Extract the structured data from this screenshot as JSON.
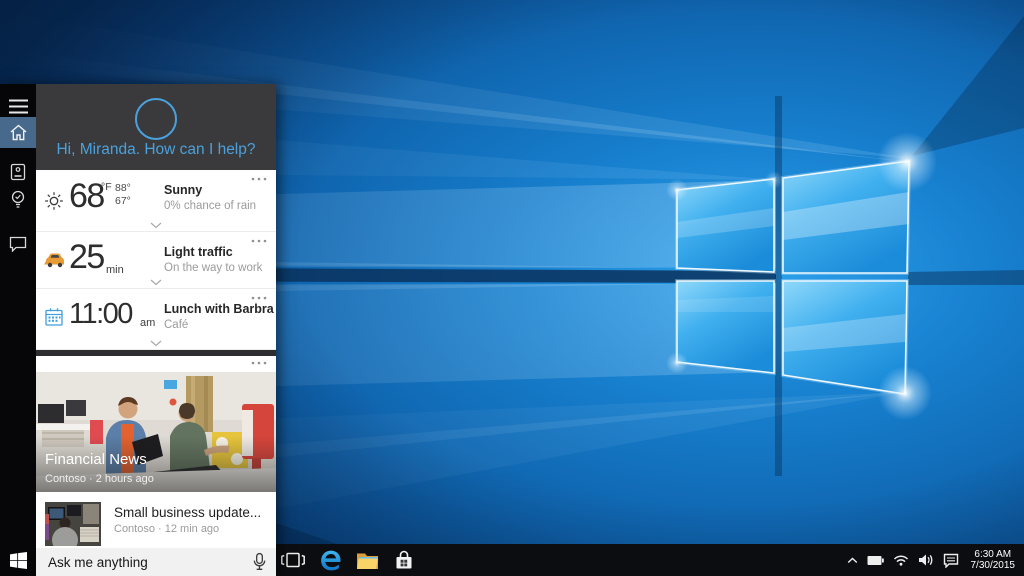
{
  "cortana": {
    "accent_color": "#4aa1dc",
    "greeting": "Hi, Miranda. How can I help?",
    "cards": [
      {
        "icon": "sun-icon",
        "value": "68",
        "unit": "°F",
        "high": "88°",
        "low": "67°",
        "title": "Sunny",
        "subtitle": "0% chance of rain"
      },
      {
        "icon": "car-icon",
        "value": "25",
        "unit": "min",
        "title": "Light traffic",
        "subtitle": "On the way to work"
      },
      {
        "icon": "calendar-icon",
        "value": "11:00",
        "unit": "am",
        "title": "Lunch with Barbra",
        "subtitle": "Café"
      }
    ],
    "news": {
      "headline": "Financial News",
      "meta": "Contoso · 2 hours ago",
      "items": [
        {
          "title": "Small business update...",
          "meta": "Contoso · 12 min ago"
        }
      ]
    },
    "search_placeholder": "Ask me anything"
  },
  "taskbar": {
    "tray": {
      "time": "6:30 AM",
      "date": "7/30/2015"
    }
  },
  "icons": {
    "sidebar": [
      "hamburger-menu-icon",
      "home-icon",
      "notebook-icon",
      "reminders-icon",
      "feedback-icon"
    ],
    "cards": [
      "sun-icon",
      "car-icon",
      "calendar-icon",
      "more-options-icon",
      "expand-chevron-icon"
    ],
    "taskbar": [
      "start-icon",
      "task-view-icon",
      "edge-icon",
      "file-explorer-icon",
      "store-icon"
    ],
    "tray": [
      "tray-expand-icon",
      "battery-icon",
      "wifi-icon",
      "volume-icon",
      "action-center-icon"
    ],
    "search": [
      "microphone-icon",
      "cortana-ring-icon"
    ]
  },
  "colors": {
    "taskbar": "#0c0d11",
    "panel_header": "#3a3a3d",
    "sidebar": "#060608",
    "home_tile": "#47698b",
    "card_bg": "#ffffff",
    "wallpaper_base": "#0f62ab"
  }
}
